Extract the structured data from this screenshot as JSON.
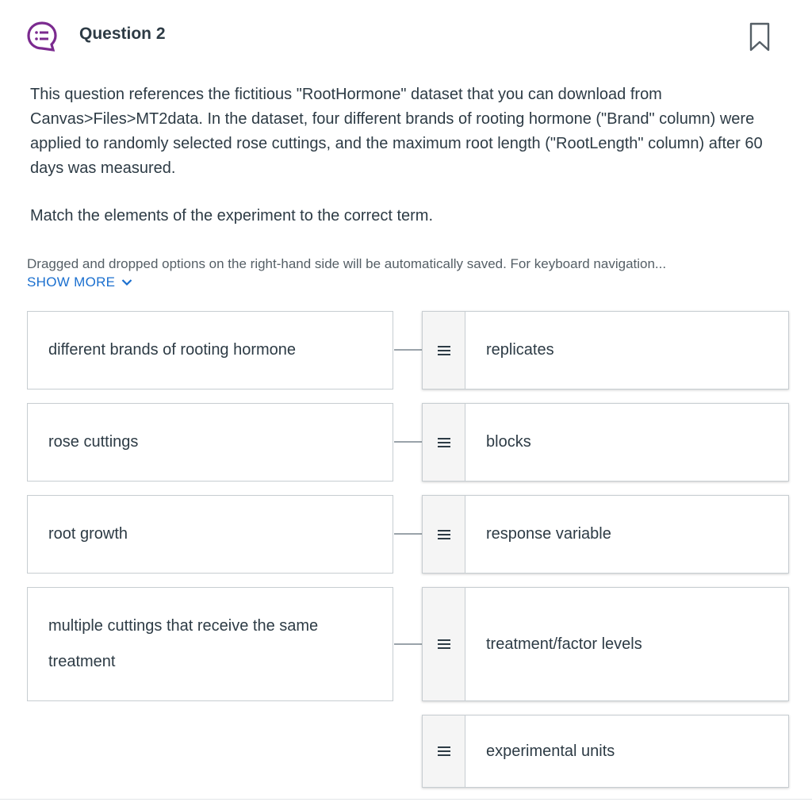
{
  "question": {
    "title": "Question 2",
    "prompt": "This question references the fictitious \"RootHormone\" dataset that you can download from Canvas>Files>MT2data. In the dataset, four different brands of rooting hormone (\"Brand\" column) were applied to randomly selected rose cuttings, and the maximum root length (\"RootLength\" column) after 60 days was measured.",
    "instruction": "Match the elements of the experiment to the correct term.",
    "note": "Dragged and dropped options on the right-hand side will be automatically saved. For keyboard navigation...",
    "show_more": "SHOW MORE",
    "icon": "question-chat-icon",
    "bookmark_icon": "bookmark-icon",
    "accent_color": "#7b2a8f",
    "link_color": "#1a6fcf"
  },
  "match": {
    "left": [
      "different brands of rooting hormone",
      "rose cuttings",
      "root growth",
      "multiple cuttings that receive the same treatment"
    ],
    "right": [
      "replicates",
      "blocks",
      "response variable",
      "treatment/factor levels",
      "experimental units"
    ],
    "handle_icon": "drag-handle-icon"
  }
}
